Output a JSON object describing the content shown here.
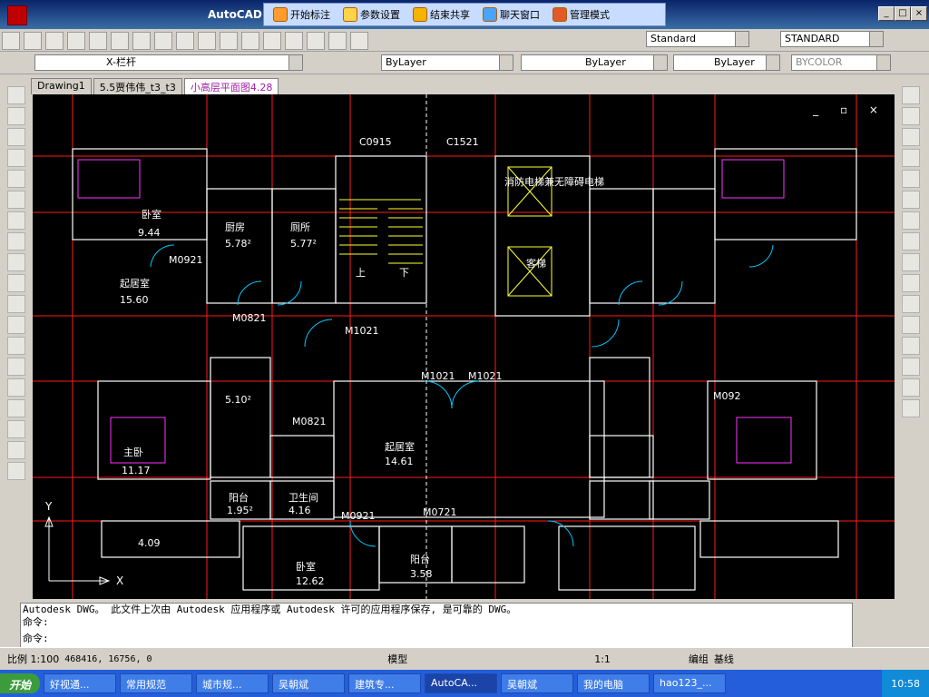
{
  "window": {
    "title": "AutoCAD 2"
  },
  "cad_menu": {
    "items": [
      "开始标注",
      "参数设置",
      "结束共享",
      "聊天窗口",
      "管理模式"
    ]
  },
  "styles": {
    "text_style": "Standard",
    "dim_style": "STANDARD"
  },
  "layers": {
    "current_layer": "X-栏杆",
    "color": "ByLayer",
    "linetype": "ByLayer",
    "lineweight": "ByLayer",
    "plot_style": "BYCOLOR"
  },
  "tabs": [
    "Drawing1",
    "5.5贾伟伟_t3_t3",
    "小高层平面图4.28"
  ],
  "chart_data": {
    "type": "floor-plan",
    "title": "",
    "labels": [
      "C0915",
      "C1521",
      "消防电梯兼无障碍电梯",
      "客梯",
      "卧室",
      "9.44",
      "厨房",
      "5.78²",
      "厕所",
      "5.77²",
      "M0921",
      "起居室",
      "15.60",
      "M0821",
      "M1021",
      "上",
      "下",
      "主卧",
      "11.17",
      "阳台",
      "1.95²",
      "卫生间",
      "4.16",
      "4.09",
      "起居室",
      "14.61",
      "M0721",
      "卧室",
      "12.62",
      "阳台",
      "3.58",
      "M0921",
      "M0821",
      "5.10²",
      "M092",
      "M1021",
      "M1021"
    ],
    "axis": [
      "X",
      "Y"
    ],
    "colors": {
      "background": "#000000",
      "grid": "#ff0000",
      "walls": "#ffffff",
      "doors": "#00c8ff",
      "stairs": "#ffff00",
      "furniture": "#ff00ff"
    }
  },
  "command_line": {
    "line1": "Autodesk DWG。  此文件上次由 Autodesk 应用程序或 Autodesk 许可的应用程序保存, 是可靠的 DWG。",
    "line2": "命令:",
    "line3": "命令:"
  },
  "status": {
    "scale": "比例 1:100",
    "coords": "468416, 16756, 0",
    "model": "模型",
    "annotation_scale": "1:1",
    "edit_label": "编组",
    "base_label": "基线"
  },
  "taskbar": {
    "start": "开始",
    "items": [
      "好视通...",
      "常用规范",
      "城市规...",
      "吴朝斌",
      "建筑专...",
      "AutoCA...",
      "吴朝斌",
      "我的电脑",
      "hao123_..."
    ],
    "time": "10:58"
  }
}
